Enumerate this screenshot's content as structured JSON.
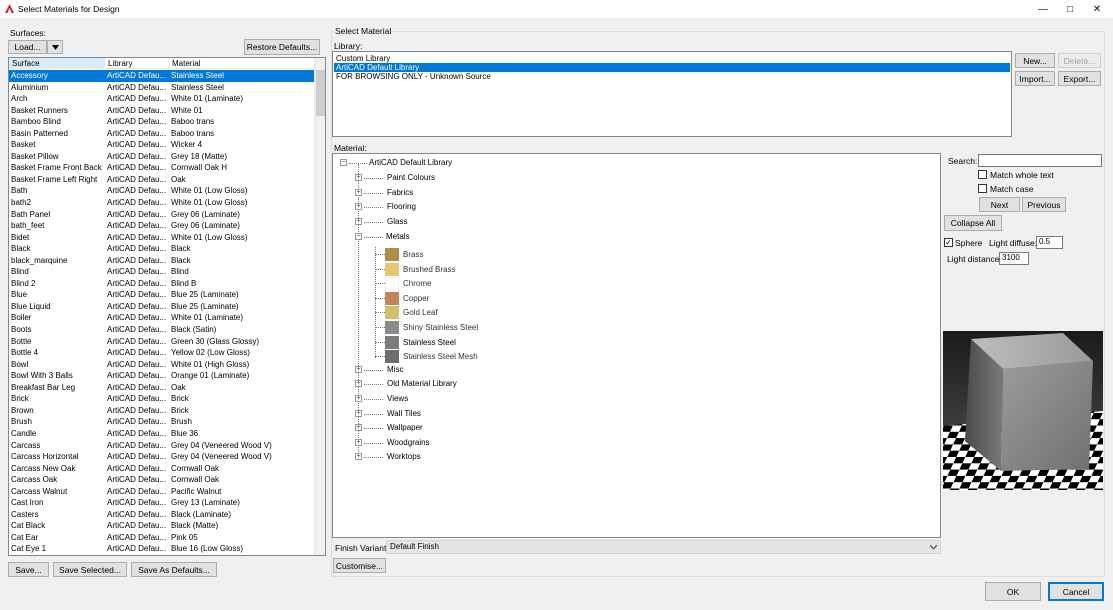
{
  "window": {
    "title": "Select Materials for Design"
  },
  "surfaces": {
    "label": "Surfaces:",
    "load_label": "Load...",
    "restore_label": "Restore Defaults...",
    "columns": [
      "Surface",
      "Library",
      "Material"
    ],
    "rows": [
      {
        "surface": "Accessory",
        "library": "ArtiCAD Defau...",
        "material": "Stainless Steel"
      },
      {
        "surface": "Aluminium",
        "library": "ArtiCAD Defau...",
        "material": "Stainless Steel"
      },
      {
        "surface": "Arch",
        "library": "ArtiCAD Defau...",
        "material": "White 01 (Laminate)"
      },
      {
        "surface": "Basket Runners",
        "library": "ArtiCAD Defau...",
        "material": "White 01"
      },
      {
        "surface": "Bamboo Blind",
        "library": "ArtiCAD Defau...",
        "material": "Baboo trans"
      },
      {
        "surface": "Basin Patterned",
        "library": "ArtiCAD Defau...",
        "material": "Baboo trans"
      },
      {
        "surface": "Basket",
        "library": "ArtiCAD Defau...",
        "material": "Wicker 4"
      },
      {
        "surface": "Basket Pillow",
        "library": "ArtiCAD Defau...",
        "material": "Grey 18 (Matte)"
      },
      {
        "surface": "Basket Frame Front Back",
        "library": "ArtiCAD Defau...",
        "material": "Cornwall Oak H"
      },
      {
        "surface": "Basket Frame Left Right",
        "library": "ArtiCAD Defau...",
        "material": "Oak"
      },
      {
        "surface": "Bath",
        "library": "ArtiCAD Defau...",
        "material": "White 01 (Low Gloss)"
      },
      {
        "surface": "bath2",
        "library": "ArtiCAD Defau...",
        "material": "White 01 (Low Gloss)"
      },
      {
        "surface": "Bath Panel",
        "library": "ArtiCAD Defau...",
        "material": "Grey 06 (Laminate)"
      },
      {
        "surface": "bath_feet",
        "library": "ArtiCAD Defau...",
        "material": "Grey 06 (Laminate)"
      },
      {
        "surface": "Bidet",
        "library": "ArtiCAD Defau...",
        "material": "White 01 (Low Gloss)"
      },
      {
        "surface": "Black",
        "library": "ArtiCAD Defau...",
        "material": "Black"
      },
      {
        "surface": "black_marquine",
        "library": "ArtiCAD Defau...",
        "material": "Black"
      },
      {
        "surface": "Blind",
        "library": "ArtiCAD Defau...",
        "material": "Blind"
      },
      {
        "surface": "Blind 2",
        "library": "ArtiCAD Defau...",
        "material": "Blind B"
      },
      {
        "surface": "Blue",
        "library": "ArtiCAD Defau...",
        "material": "Blue 25 (Laminate)"
      },
      {
        "surface": "Blue Liquid",
        "library": "ArtiCAD Defau...",
        "material": "Blue 25 (Laminate)"
      },
      {
        "surface": "Boiler",
        "library": "ArtiCAD Defau...",
        "material": "White 01 (Laminate)"
      },
      {
        "surface": "Boots",
        "library": "ArtiCAD Defau...",
        "material": "Black (Satin)"
      },
      {
        "surface": "Bottle",
        "library": "ArtiCAD Defau...",
        "material": "Green 30 (Glass Glossy)"
      },
      {
        "surface": "Bottle 4",
        "library": "ArtiCAD Defau...",
        "material": "Yellow 02 (Low Gloss)"
      },
      {
        "surface": "Bowl",
        "library": "ArtiCAD Defau...",
        "material": "White 01 (High Gloss)"
      },
      {
        "surface": "Bowl With 3 Balls",
        "library": "ArtiCAD Defau...",
        "material": "Orange 01 (Laminate)"
      },
      {
        "surface": "Breakfast Bar Leg",
        "library": "ArtiCAD Defau...",
        "material": "Oak"
      },
      {
        "surface": "Brick",
        "library": "ArtiCAD Defau...",
        "material": "Brick"
      },
      {
        "surface": "Brown",
        "library": "ArtiCAD Defau...",
        "material": "Brick"
      },
      {
        "surface": "Brush",
        "library": "ArtiCAD Defau...",
        "material": "Brush"
      },
      {
        "surface": "Candle",
        "library": "ArtiCAD Defau...",
        "material": "Blue 36"
      },
      {
        "surface": "Carcass",
        "library": "ArtiCAD Defau...",
        "material": "Grey 04 (Veneered Wood V)"
      },
      {
        "surface": "Carcass Horizontal",
        "library": "ArtiCAD Defau...",
        "material": "Grey 04 (Veneered Wood V)"
      },
      {
        "surface": "Carcass New Oak",
        "library": "ArtiCAD Defau...",
        "material": "Cornwall Oak"
      },
      {
        "surface": "Carcass Oak",
        "library": "ArtiCAD Defau...",
        "material": "Cornwall Oak"
      },
      {
        "surface": "Carcass Walnut",
        "library": "ArtiCAD Defau...",
        "material": "Pacific Walnut"
      },
      {
        "surface": "Cast Iron",
        "library": "ArtiCAD Defau...",
        "material": "Grey 13 (Laminate)"
      },
      {
        "surface": "Casters",
        "library": "ArtiCAD Defau...",
        "material": "Black (Laminate)"
      },
      {
        "surface": "Cat Black",
        "library": "ArtiCAD Defau...",
        "material": "Black (Matte)"
      },
      {
        "surface": "Cat Ear",
        "library": "ArtiCAD Defau...",
        "material": "Pink 05"
      },
      {
        "surface": "Cat Eye 1",
        "library": "ArtiCAD Defau...",
        "material": "Blue 16 (Low Gloss)"
      }
    ],
    "save_label": "Save...",
    "save_selected_label": "Save Selected...",
    "save_defaults_label": "Save As Defaults..."
  },
  "select_material": {
    "group_label": "Select Material",
    "library_label": "Library:",
    "libraries": [
      "Custom Library",
      "ArtiCAD Default Library",
      "FOR BROWSING ONLY - Unknown Source"
    ],
    "new_label": "New...",
    "delete_label": "Delete...",
    "import_label": "Import...",
    "export_label": "Export...",
    "material_label": "Material:",
    "tree_root": "ArtiCAD Default Library",
    "categories_top": [
      "Paint Colours",
      "Fabrics",
      "Flooring",
      "Glass",
      "Metals"
    ],
    "metals": [
      {
        "name": "Brass",
        "color": "#b08d4a"
      },
      {
        "name": "Brushed Brass",
        "color": "#e8c46c"
      },
      {
        "name": "Chrome",
        "color": "#ffffff"
      },
      {
        "name": "Copper",
        "color": "#c4845a"
      },
      {
        "name": "Gold Leaf",
        "color": "#d4c06a"
      },
      {
        "name": "Shiny Stainless Steel",
        "color": "#8a8a8a"
      },
      {
        "name": "Stainless Steel",
        "color": "#7c7c7c"
      },
      {
        "name": "Stainless Steel Mesh",
        "color": "#6e6e6e"
      }
    ],
    "categories_bottom": [
      "Misc",
      "Old Material Library",
      "Views",
      "Wall Tiles",
      "Wallpaper",
      "Woodgrains",
      "Worktops"
    ],
    "search_label": "Search:",
    "search_value": "",
    "match_whole_label": "Match whole text",
    "match_case_label": "Match case",
    "next_label": "Next",
    "previous_label": "Previous",
    "collapse_label": "Collapse All",
    "sphere_label": "Sphere",
    "sphere_checked": true,
    "light_diffuse_label": "Light diffuse:",
    "light_diffuse_value": "0.5",
    "light_distance_label": "Light distance:",
    "light_distance_value": "3100",
    "finish_variant_label": "Finish Variant:",
    "finish_variant_value": "Default Finish",
    "customise_label": "Customise..."
  },
  "footer": {
    "ok_label": "OK",
    "cancel_label": "Cancel"
  },
  "colors": {
    "selection": "#0078d7",
    "dialog_bg": "#f0f0f0"
  }
}
